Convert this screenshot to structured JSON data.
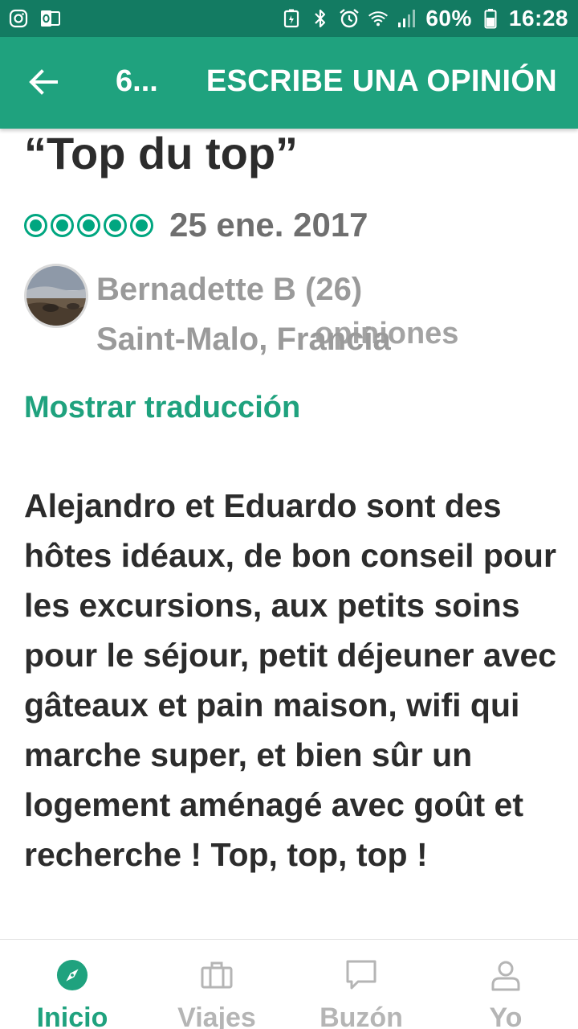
{
  "status_bar": {
    "left_icons": [
      "instagram-icon",
      "outlook-icon"
    ],
    "right_icons": [
      "battery-saver-icon",
      "bluetooth-icon",
      "alarm-icon",
      "wifi-icon",
      "signal-icon"
    ],
    "battery": "60%",
    "time": "16:28"
  },
  "app_bar": {
    "back_icon": "arrow-left-icon",
    "title": "6...",
    "write_review_label": "ESCRIBE UNA OPINIÓN"
  },
  "review": {
    "title": "“Top du top”",
    "rating": 5,
    "rating_max": 5,
    "date": "25 ene. 2017",
    "reviewer": {
      "name": "Bernadette B (26)",
      "location": "Saint-Malo, Francia",
      "opinions_label": "opiniones"
    },
    "show_translation": "Mostrar traducción",
    "body": "Alejandro et Eduardo sont des hôtes idéaux, de bon conseil pour les excursions, aux petits soins pour le séjour, petit déjeuner avec gâteaux et pain maison, wifi qui marche super, et bien sûr un logement aménagé avec goût et recherche ! Top, top, top !"
  },
  "bottom_nav": {
    "items": [
      {
        "label": "Inicio",
        "icon": "compass-icon",
        "active": true
      },
      {
        "label": "Viajes",
        "icon": "suitcase-icon",
        "active": false
      },
      {
        "label": "Buzón",
        "icon": "chat-bubble-icon",
        "active": false
      },
      {
        "label": "Yo",
        "icon": "person-icon",
        "active": false
      }
    ]
  },
  "colors": {
    "status_bar": "#137b62",
    "app_bar": "#1fa27e",
    "accent": "#00a680",
    "muted_text": "#9a9a9a"
  }
}
